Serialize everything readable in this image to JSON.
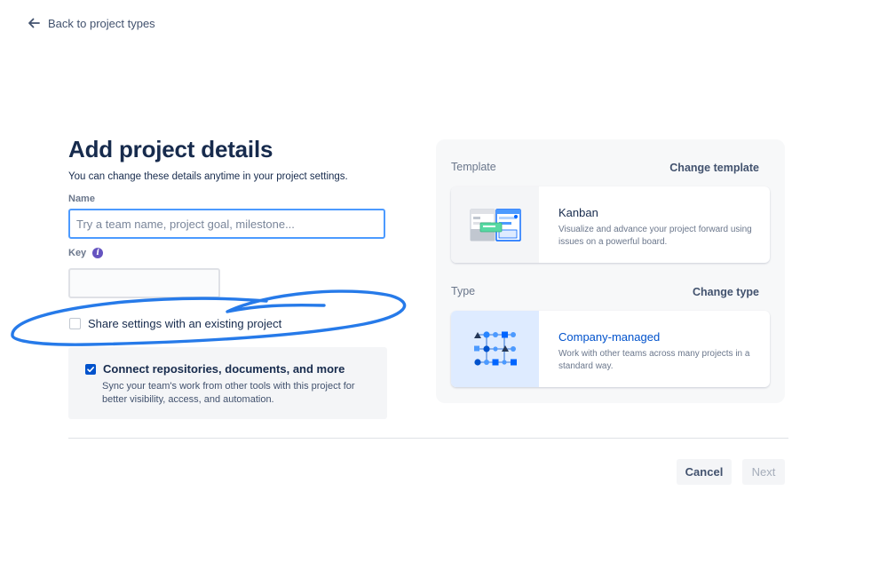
{
  "nav": {
    "back_label": "Back to project types"
  },
  "header": {
    "title": "Add project details",
    "subtitle": "You can change these details anytime in your project settings."
  },
  "form": {
    "name_label": "Name",
    "name_placeholder": "Try a team name, project goal, milestone...",
    "name_value": "",
    "key_label": "Key",
    "key_value": "",
    "share_label": "Share settings with an existing project",
    "share_checked": false,
    "connect_title": "Connect repositories, documents, and more",
    "connect_desc": "Sync your team's work from other tools with this project for better visibility, access, and automation.",
    "connect_checked": true
  },
  "panel": {
    "template_heading": "Template",
    "change_template_label": "Change template",
    "template_card": {
      "title": "Kanban",
      "desc": "Visualize and advance your project forward using issues on a powerful board."
    },
    "type_heading": "Type",
    "change_type_label": "Change type",
    "type_card": {
      "title": "Company-managed",
      "desc": "Work with other teams across many projects in a standard way."
    }
  },
  "footer": {
    "cancel_label": "Cancel",
    "next_label": "Next"
  },
  "colors": {
    "accent": "#0052cc",
    "focus_border": "#4c9aff",
    "annotation_stroke": "#1a73e8",
    "info_icon": "#6554c0"
  },
  "icons": [
    "arrow-left-icon",
    "info-icon",
    "checkmark-icon",
    "kanban-board-illustration",
    "company-managed-illustration"
  ]
}
